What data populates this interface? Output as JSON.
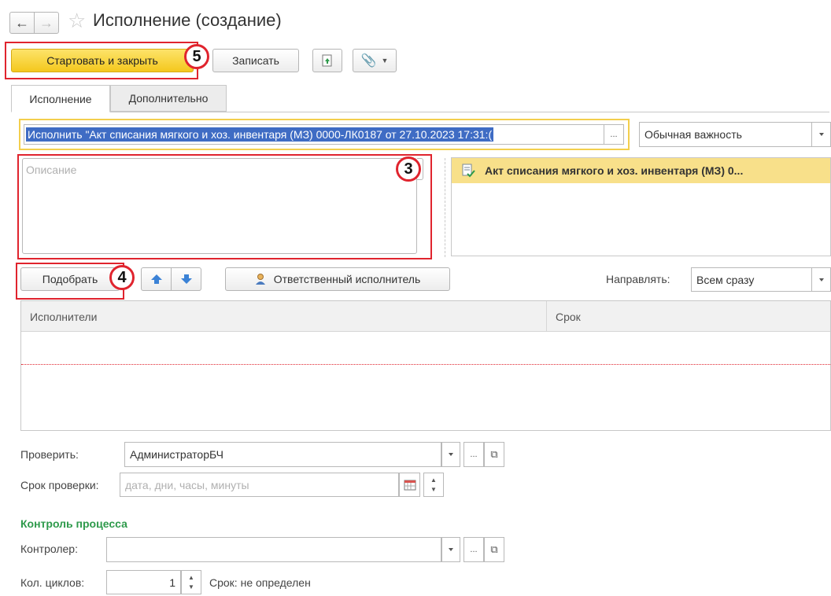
{
  "window": {
    "title": "Исполнение (создание)"
  },
  "toolbar": {
    "start_close_label": "Стартовать и закрыть",
    "save_label": "Записать"
  },
  "tabs": [
    {
      "label": "Исполнение"
    },
    {
      "label": "Дополнительно"
    }
  ],
  "form": {
    "subject_value": "Исполнить \"Акт списания мягкого и хоз. инвентаря (МЗ) 0000-ЛК0187 от 27.10.2023 17:31:(",
    "ellipsis": "...",
    "importance_value": "Обычная важность",
    "description_placeholder": "Описание",
    "attachment_title": "Акт списания мягкого и хоз. инвентаря (МЗ) 0..."
  },
  "performers": {
    "pick_label": "Подобрать",
    "responsible_label": "Ответственный исполнитель",
    "send_label": "Направлять:",
    "send_value": "Всем сразу",
    "col_performers": "Исполнители",
    "col_deadline": "Срок"
  },
  "check": {
    "check_label": "Проверить:",
    "check_value": "АдминистраторБЧ",
    "check_deadline_label": "Срок проверки:",
    "check_deadline_placeholder": "дата, дни, часы, минуты"
  },
  "control": {
    "section_title": "Контроль процесса",
    "controller_label": "Контролер:",
    "cycles_label": "Кол. циклов:",
    "cycles_value": "1",
    "term_text": "Срок: не определен"
  },
  "annotations": {
    "badge_3": "3",
    "badge_4": "4",
    "badge_5": "5"
  },
  "colors": {
    "accent_yellow": "#f8d12e",
    "highlight_red": "#e0242e",
    "selection_blue": "#3f6cc4",
    "section_green": "#2e9a4b",
    "arrow_blue": "#3b82d6"
  }
}
